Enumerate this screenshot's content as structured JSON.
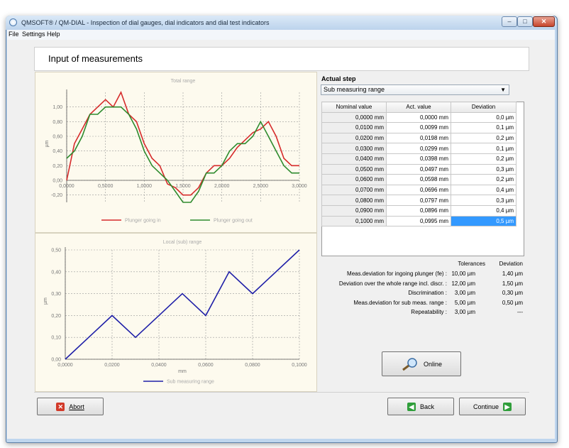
{
  "window": {
    "title": "QMSOFT® / QM-DIAL - Inspection of dial gauges, dial indicators and dial test indicators"
  },
  "menu": [
    "File",
    "Settings",
    "Help"
  ],
  "page": {
    "title": "Input of measurements"
  },
  "step": {
    "label": "Actual step",
    "selected": "Sub measuring range"
  },
  "table": {
    "headers": [
      "Nominal value",
      "Act. value",
      "Deviation"
    ],
    "rows": [
      [
        "0,0000 mm",
        "0,0000 mm",
        "0,0 µm"
      ],
      [
        "0,0100 mm",
        "0,0099 mm",
        "0,1 µm"
      ],
      [
        "0,0200 mm",
        "0,0198 mm",
        "0,2 µm"
      ],
      [
        "0,0300 mm",
        "0,0299 mm",
        "0,1 µm"
      ],
      [
        "0,0400 mm",
        "0,0398 mm",
        "0,2 µm"
      ],
      [
        "0,0500 mm",
        "0,0497 mm",
        "0,3 µm"
      ],
      [
        "0,0600 mm",
        "0,0598 mm",
        "0,2 µm"
      ],
      [
        "0,0700 mm",
        "0,0696 mm",
        "0,4 µm"
      ],
      [
        "0,0800 mm",
        "0,0797 mm",
        "0,3 µm"
      ],
      [
        "0,0900 mm",
        "0,0896 mm",
        "0,4 µm"
      ],
      [
        "0,1000 mm",
        "0,0995 mm",
        "0,5 µm"
      ]
    ],
    "selected_row": 10
  },
  "tolerances": {
    "header_tol": "Tolerances",
    "header_dev": "Deviation",
    "rows": [
      {
        "label": "Meas.deviation for ingoing plunger (fe) :",
        "tol": "10,00 µm",
        "dev": "1,40 µm"
      },
      {
        "label": "Deviation over the whole range incl. discr. :",
        "tol": "12,00 µm",
        "dev": "1,50 µm"
      },
      {
        "label": "Discrimination :",
        "tol": "3,00 µm",
        "dev": "0,30 µm"
      },
      {
        "label": "Meas.deviation for sub meas. range :",
        "tol": "5,00 µm",
        "dev": "0,50 µm"
      },
      {
        "label": "Repeatability :",
        "tol": "3,00 µm",
        "dev": "---"
      }
    ]
  },
  "buttons": {
    "online": "Online",
    "abort": "Abort",
    "back": "Back",
    "continue": "Continue"
  },
  "colors": {
    "in": "#d62b2b",
    "out": "#2e8b2e",
    "sub": "#1f1fa8",
    "chart_bg": "#fdfaee",
    "accent": "#3399ff"
  },
  "chart_data": [
    {
      "type": "line",
      "title": "Total range",
      "ylabel": "µm",
      "xlabel": "",
      "xlim": [
        0,
        3
      ],
      "ylim": [
        -0.3,
        1.2
      ],
      "xticks": [
        "0,0000",
        "0,5000",
        "1,0000",
        "1,5000",
        "2,0000",
        "2,5000",
        "3,0000"
      ],
      "yticks": [
        "-0,20",
        "0,00",
        "0,20",
        "0,40",
        "0,60",
        "0,80",
        "1,00"
      ],
      "yticks_values": [
        -0.2,
        0,
        0.2,
        0.4,
        0.6,
        0.8,
        1.0
      ],
      "series": [
        {
          "name": "Plunger going in",
          "x": [
            0,
            0.1,
            0.2,
            0.3,
            0.4,
            0.5,
            0.6,
            0.7,
            0.8,
            0.9,
            1.0,
            1.1,
            1.2,
            1.3,
            1.4,
            1.5,
            1.6,
            1.7,
            1.8,
            1.9,
            2.0,
            2.1,
            2.2,
            2.3,
            2.4,
            2.5,
            2.6,
            2.7,
            2.8,
            2.9,
            3.0
          ],
          "y": [
            0,
            0.5,
            0.7,
            0.9,
            1.0,
            1.1,
            1.0,
            1.2,
            0.9,
            0.8,
            0.5,
            0.3,
            0.2,
            -0.05,
            -0.1,
            -0.2,
            -0.2,
            -0.1,
            0.1,
            0.2,
            0.2,
            0.3,
            0.45,
            0.55,
            0.65,
            0.7,
            0.8,
            0.6,
            0.3,
            0.2,
            0.2
          ]
        },
        {
          "name": "Plunger going out",
          "x": [
            0,
            0.1,
            0.2,
            0.3,
            0.4,
            0.5,
            0.6,
            0.7,
            0.8,
            0.9,
            1.0,
            1.1,
            1.2,
            1.3,
            1.4,
            1.5,
            1.6,
            1.7,
            1.8,
            1.9,
            2.0,
            2.1,
            2.2,
            2.3,
            2.4,
            2.5,
            2.6,
            2.7,
            2.8,
            2.9,
            3.0
          ],
          "y": [
            0.3,
            0.4,
            0.6,
            0.9,
            0.9,
            1.0,
            1.0,
            1.0,
            0.9,
            0.7,
            0.4,
            0.2,
            0.1,
            0.0,
            -0.15,
            -0.3,
            -0.3,
            -0.15,
            0.1,
            0.1,
            0.2,
            0.4,
            0.5,
            0.5,
            0.6,
            0.8,
            0.6,
            0.4,
            0.2,
            0.1,
            0.1
          ]
        }
      ],
      "legend": "bottom",
      "grid": true
    },
    {
      "type": "line",
      "title": "Local (sub) range",
      "ylabel": "µm",
      "xlabel": "mm",
      "xlim": [
        0,
        0.1
      ],
      "ylim": [
        0,
        0.5
      ],
      "xticks": [
        "0,0000",
        "0,0200",
        "0,0400",
        "0,0600",
        "0,0800",
        "0,1000"
      ],
      "yticks": [
        "0,00",
        "0,10",
        "0,20",
        "0,30",
        "0,40",
        "0,50"
      ],
      "yticks_values": [
        0,
        0.1,
        0.2,
        0.3,
        0.4,
        0.5
      ],
      "series": [
        {
          "name": "Sub measuring range",
          "x": [
            0,
            0.01,
            0.02,
            0.03,
            0.04,
            0.05,
            0.06,
            0.07,
            0.08,
            0.09,
            0.1
          ],
          "y": [
            0,
            0.1,
            0.2,
            0.1,
            0.2,
            0.3,
            0.2,
            0.4,
            0.3,
            0.4,
            0.5
          ]
        }
      ],
      "legend": "bottom",
      "grid": true
    }
  ]
}
